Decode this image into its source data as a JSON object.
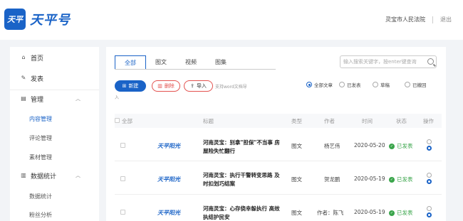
{
  "header": {
    "logo_badge": "天平",
    "logo_text": "天平号",
    "org_name": "灵宝市人民法院",
    "logout": "退出"
  },
  "sidebar": {
    "items": [
      {
        "label": "首页",
        "icon": "home-icon"
      },
      {
        "label": "发表",
        "icon": "edit-icon"
      },
      {
        "label": "管理",
        "icon": "manage-icon",
        "chevron": "︿"
      },
      {
        "label": "数据统计",
        "icon": "chart-icon",
        "chevron": "︿"
      }
    ],
    "manage_sub": [
      "内容管理",
      "评论管理",
      "素材管理"
    ],
    "stats_sub": [
      "数据统计",
      "粉丝分析"
    ]
  },
  "tabs": [
    "全部",
    "图文",
    "视频",
    "图集"
  ],
  "search": {
    "placeholder": "输入搜索关键字，按enter键查询"
  },
  "toolbar": {
    "new_label": "新建",
    "delete_label": "删除",
    "import_label": "导入",
    "support_text": "支持word文档导",
    "support_tail": "入"
  },
  "filters": [
    "全部文章",
    "已发表",
    "草稿",
    "已撤回"
  ],
  "table": {
    "headers": {
      "all": "全部",
      "title": "标题",
      "type": "类型",
      "author": "作者",
      "time": "时间",
      "status": "状态",
      "ops": "操作"
    },
    "rows": [
      {
        "thumb": "天平阳光",
        "title": "河南灵宝：别拿\"担保\"不当事 房屋险失忙翻行",
        "type": "图文",
        "author": "杨艺伟",
        "time": "2020-05-20",
        "status": "已发表"
      },
      {
        "thumb": "天平阳光",
        "title": "河南灵宝：执行干警转变思路 及时扣划巧结案",
        "type": "图文",
        "author": "贺龙鹏",
        "time": "2020-05-19",
        "status": "已发表"
      },
      {
        "thumb": "天平阳光",
        "title": "河南灵宝：心存侥幸躲执行 高效执结护民安",
        "type": "图文",
        "author": "作者：陈飞",
        "time": "2020-05-19",
        "status": "已发表"
      }
    ]
  },
  "colors": {
    "accent": "#1a63c7",
    "danger": "#e3524f",
    "success": "#3aa54b"
  }
}
